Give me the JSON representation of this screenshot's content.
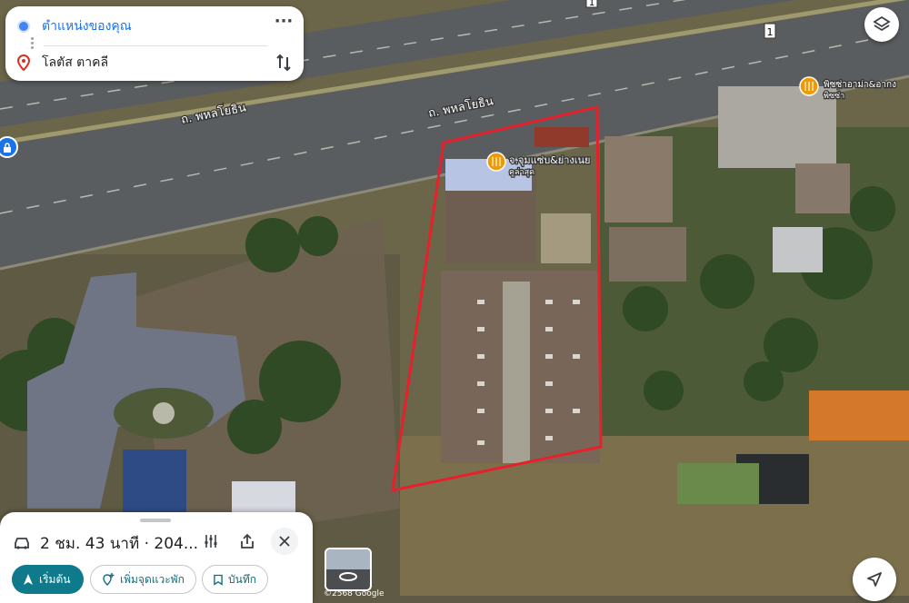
{
  "route": {
    "origin": "ตำแหน่งของคุณ",
    "destination": "โลตัส ตาคลี",
    "more_icon": "more-horizontal-icon",
    "swap_icon": "swap-vertical-icon"
  },
  "map": {
    "road_label_1": "ถ. พหลโยธิน",
    "road_label_2": "ถ. พหลโยธิน",
    "route_shield": "1",
    "place_1_name": "จ.จุมแซ่บ&ย่างเนย",
    "place_1_sub": "คูล่าสุด",
    "place_2_name": "พิซซ่าอาม่า&อากง",
    "place_2_sub": "พิซซ่า",
    "plot_outline_color": "#e8202c"
  },
  "controls": {
    "layers_icon": "layers-icon",
    "navigation_icon": "navigation-arrow-icon",
    "lock_icon": "lock-icon"
  },
  "bottom_sheet": {
    "trip_summary": "2 ชม. 43 นาที · 204...",
    "car_icon": "car-icon",
    "options_icon": "options-sliders-icon",
    "share_icon": "share-icon",
    "close_icon": "close-icon",
    "start_label": "เริ่มต้น",
    "add_stop_label": "เพิ่มจุดแวะพัก",
    "save_label": "บันทึก"
  },
  "attribution": "©2568 Google"
}
